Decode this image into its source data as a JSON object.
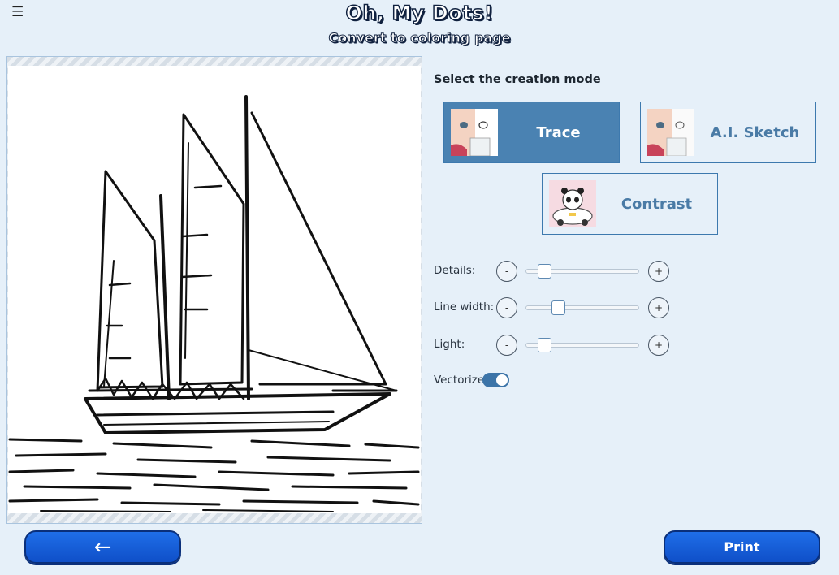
{
  "header": {
    "menu_icon": "☰",
    "app_title": "Oh, My Dots!",
    "subtitle": "Convert to coloring page"
  },
  "modes": {
    "heading": "Select the creation mode",
    "options": [
      {
        "label": "Trace",
        "active": true,
        "icon": "baby-face-trace-thumbnail"
      },
      {
        "label": "A.I. Sketch",
        "active": false,
        "icon": "baby-face-sketch-thumbnail"
      },
      {
        "label": "Contrast",
        "active": false,
        "icon": "panda-car-thumbnail"
      }
    ]
  },
  "controls": {
    "details": {
      "label": "Details:",
      "minus": "-",
      "plus": "+",
      "level": 0.12
    },
    "line_width": {
      "label": "Line width:",
      "minus": "-",
      "plus": "+",
      "level": 0.26
    },
    "light": {
      "label": "Light:",
      "minus": "-",
      "plus": "+",
      "level": 0.12
    },
    "vectorize": {
      "label": "Vectorize",
      "on": true
    }
  },
  "footer": {
    "back_label": "←",
    "print_label": "Print"
  },
  "colors": {
    "accent": "#4a82b2",
    "background": "#e6f0f9",
    "button": "#1558d6"
  }
}
